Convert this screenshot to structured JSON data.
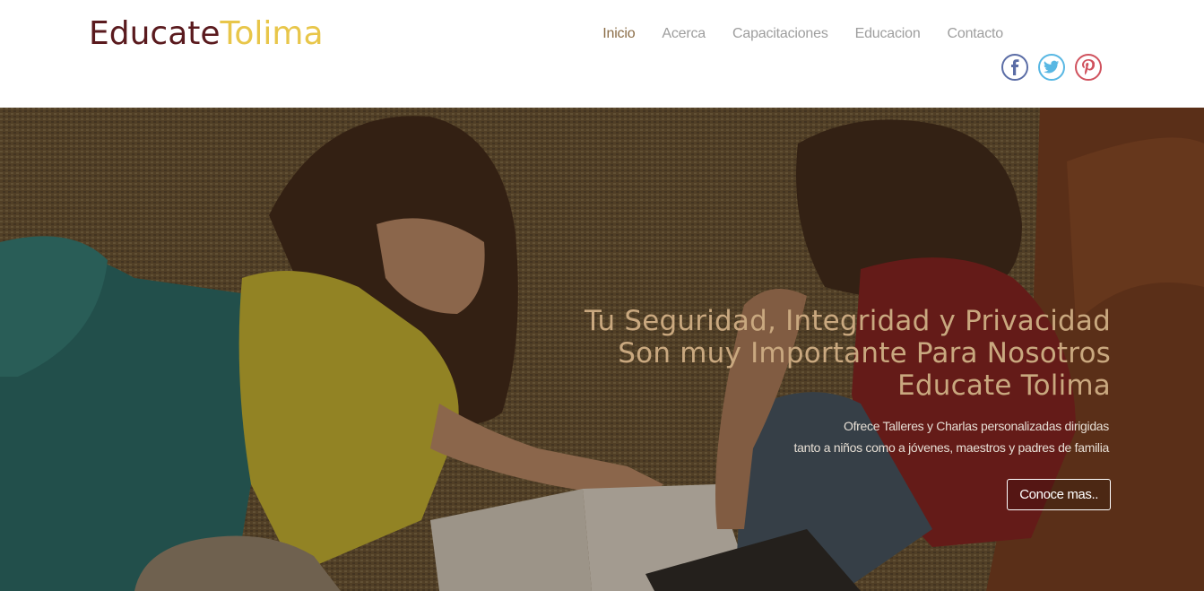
{
  "header": {
    "logo": {
      "part1": "Educate",
      "part2": "Tolima"
    },
    "nav": [
      {
        "label": "Inicio",
        "active": true
      },
      {
        "label": "Acerca"
      },
      {
        "label": "Capacitaciones"
      },
      {
        "label": "Educacion"
      },
      {
        "label": "Contacto"
      }
    ],
    "social": [
      {
        "name": "facebook-icon",
        "glyph": "f",
        "color": "#5b6da6"
      },
      {
        "name": "twitter-icon",
        "glyph": "t",
        "color": "#58b7e3"
      },
      {
        "name": "pinterest-icon",
        "glyph": "p",
        "color": "#d0525e"
      }
    ]
  },
  "hero": {
    "title_lines": [
      "Tu Seguridad, Integridad y Privacidad",
      "Son muy Importante Para Nosotros",
      "Educate Tolima"
    ],
    "subtitle_lines": [
      "Ofrece Talleres y Charlas personalizadas dirigidas",
      "tanto a niños como a jóvenes, maestros y padres de familia"
    ],
    "cta_label": "Conoce mas.."
  },
  "colors": {
    "logo_dark": "#5a1a1e",
    "logo_light": "#e8c64a",
    "nav_active": "#8b6d47",
    "hero_title": "#c9a87f"
  }
}
